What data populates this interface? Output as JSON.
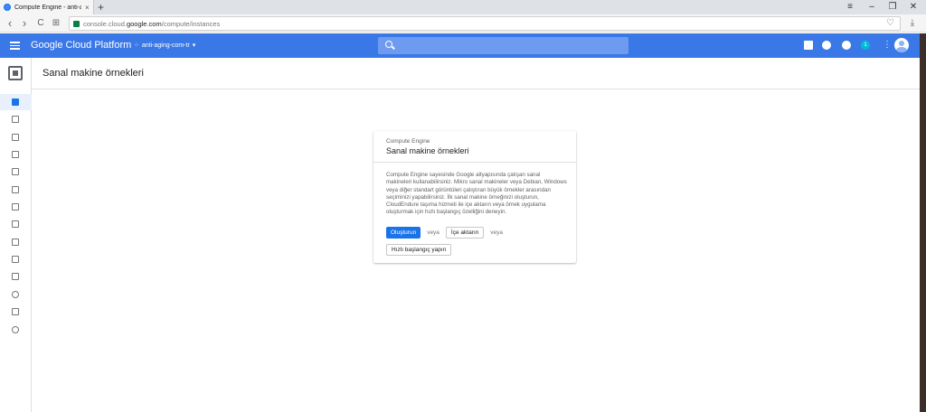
{
  "browser": {
    "tab_title": "Compute Engine - anti-ag",
    "tab_close": "×",
    "new_tab": "+",
    "url_prefix": "console.cloud.",
    "url_domain": "google.com",
    "url_path": "/compute/instances",
    "window_controls": {
      "minimize": "–",
      "restore": "❐",
      "close": "✕"
    },
    "nav": {
      "back": "‹",
      "forward": "›",
      "reload": "C",
      "apps": "⊞"
    }
  },
  "header": {
    "brand": "Google Cloud Platform",
    "project": "anti-aging-com-tr",
    "project_caret": "▾",
    "notification_count": "1"
  },
  "page": {
    "title": "Sanal makine örnekleri"
  },
  "card": {
    "kicker": "Compute Engine",
    "title": "Sanal makine örnekleri",
    "description": "Compute Engine sayesinde Google altyapısında çalışan sanal makineleri kullanabilirsiniz. Mikro sanal makineler veya Debian, Windows veya diğer standart görüntüleri çalıştıran büyük örnekler arasından seçiminizi yapabilirsiniz. İlk sanal makine örneğinizi oluşturun, CloudEndure taşıma hizmeti ile içe aktarın veya örnek uygulama oluşturmak için hızlı başlangıç özelliğini deneyin.",
    "create_button": "Oluşturun",
    "or1": "veya",
    "import_button": "İçe aktarın",
    "or2": "veya",
    "quickstart_button": "Hızlı başlangıç yapın"
  },
  "colors": {
    "header_bg": "#3b78e7",
    "primary_button": "#1a73e8",
    "search_bg": "#6d9bef"
  }
}
